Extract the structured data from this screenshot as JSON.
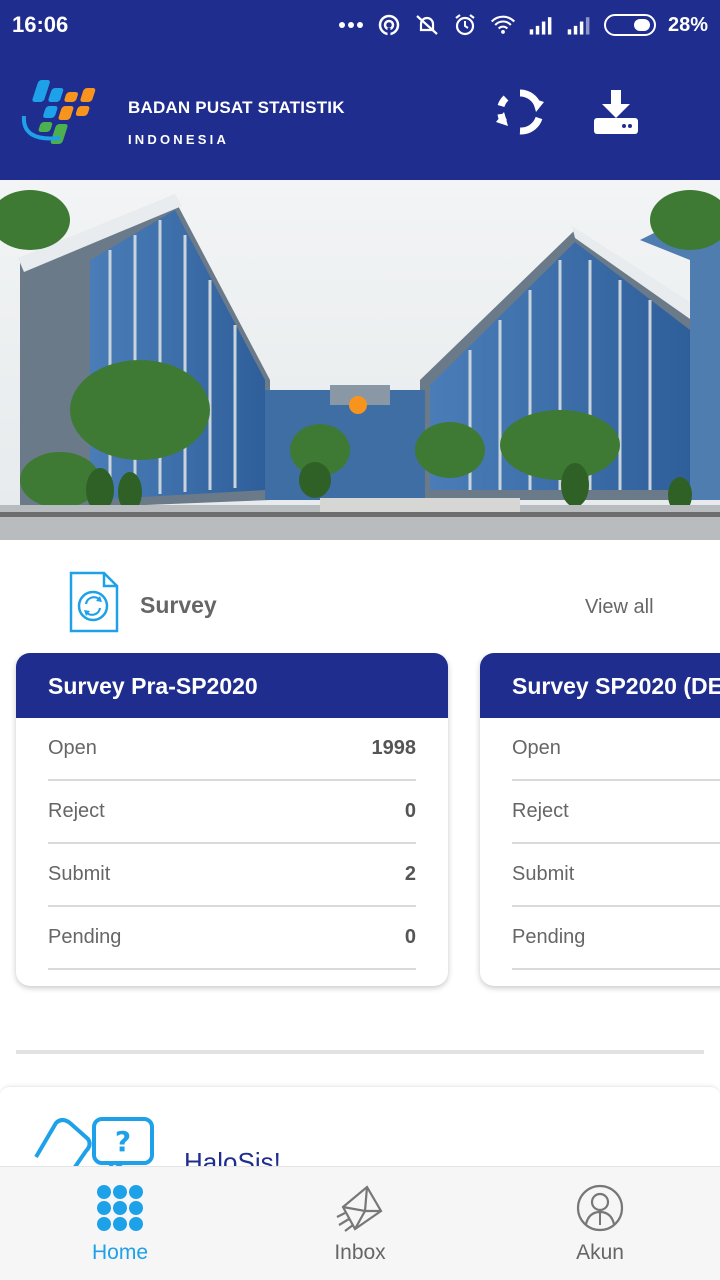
{
  "status_bar": {
    "time": "16:06",
    "battery": "28%",
    "icons": [
      "more-dots-icon",
      "hotspot-icon",
      "muted-bell-icon",
      "alarm-icon",
      "wifi-icon",
      "signal-icon",
      "signal-icon",
      "battery-icon"
    ]
  },
  "header": {
    "title": "BADAN PUSAT STATISTIK",
    "subtitle": "INDONESIA",
    "actions": [
      "sync-icon",
      "download-icon"
    ],
    "color": "#1f2d8f"
  },
  "survey_section": {
    "title": "Survey",
    "view_all": "View all",
    "cards": [
      {
        "name": "Survey Pra-SP2020",
        "rows": [
          {
            "label": "Open",
            "value": "1998"
          },
          {
            "label": "Reject",
            "value": "0"
          },
          {
            "label": "Submit",
            "value": "2"
          },
          {
            "label": "Pending",
            "value": "0"
          }
        ]
      },
      {
        "name": "Survey SP2020 (DE",
        "rows": [
          {
            "label": "Open",
            "value": ""
          },
          {
            "label": "Reject",
            "value": ""
          },
          {
            "label": "Submit",
            "value": ""
          },
          {
            "label": "Pending",
            "value": ""
          }
        ]
      }
    ]
  },
  "halo": {
    "title": "HaloSis!"
  },
  "bottom_nav": {
    "active_color": "#1ea1e8",
    "items": [
      {
        "label": "Home",
        "icon": "grid-icon",
        "active": true
      },
      {
        "label": "Inbox",
        "icon": "mail-icon",
        "active": false
      },
      {
        "label": "Akun",
        "icon": "user-icon",
        "active": false
      }
    ]
  }
}
